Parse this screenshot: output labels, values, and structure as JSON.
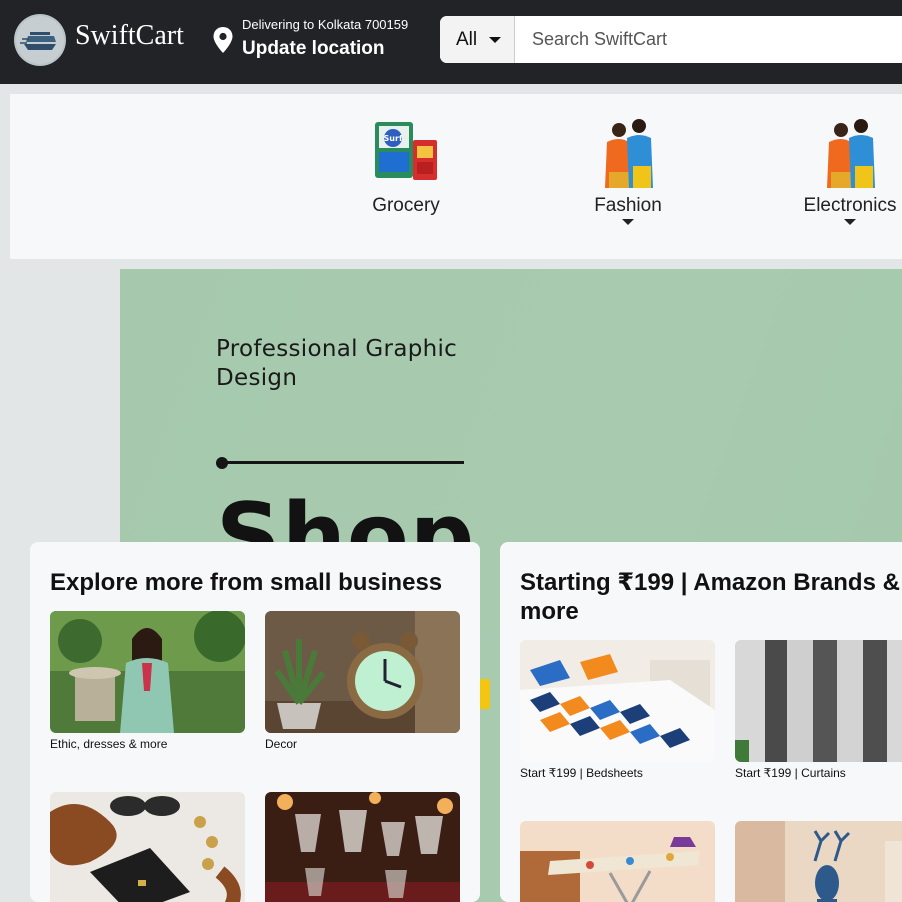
{
  "header": {
    "brand": "SwiftCart",
    "deliver_line": "Delivering to Kolkata 700159",
    "update_location": "Update location",
    "search": {
      "category": "All",
      "placeholder": "Search SwiftCart"
    },
    "icons": [
      "logo-icon",
      "location-pin-icon",
      "chevron-down-icon"
    ]
  },
  "categories": [
    {
      "label": "Grocery",
      "has_dropdown": false,
      "icon": "grocery-products-icon"
    },
    {
      "label": "Fashion",
      "has_dropdown": true,
      "icon": "fashion-couple-icon"
    },
    {
      "label": "Electronics",
      "has_dropdown": true,
      "icon": "fashion-couple-icon"
    }
  ],
  "hero": {
    "tagline_line1": "Professional Graphic",
    "tagline_line2": "Design",
    "headline": "Shop"
  },
  "cards": [
    {
      "title": "Explore more from small business",
      "tiles": [
        {
          "caption": "Ethic, dresses & more"
        },
        {
          "caption": "Decor"
        },
        {
          "caption": ""
        },
        {
          "caption": ""
        }
      ]
    },
    {
      "title_line1": "Starting ₹199 | Amazon Brands &",
      "title_line2": "more",
      "tiles": [
        {
          "caption": "Start ₹199 | Bedsheets"
        },
        {
          "caption": "Start ₹199 | Curtains"
        },
        {
          "caption": ""
        },
        {
          "caption": ""
        }
      ]
    }
  ],
  "colors": {
    "header_bg": "#212327",
    "page_bg": "#e3e6e6",
    "hero_bg": "#a8cbb0",
    "card_bg": "#f7f8fa"
  }
}
